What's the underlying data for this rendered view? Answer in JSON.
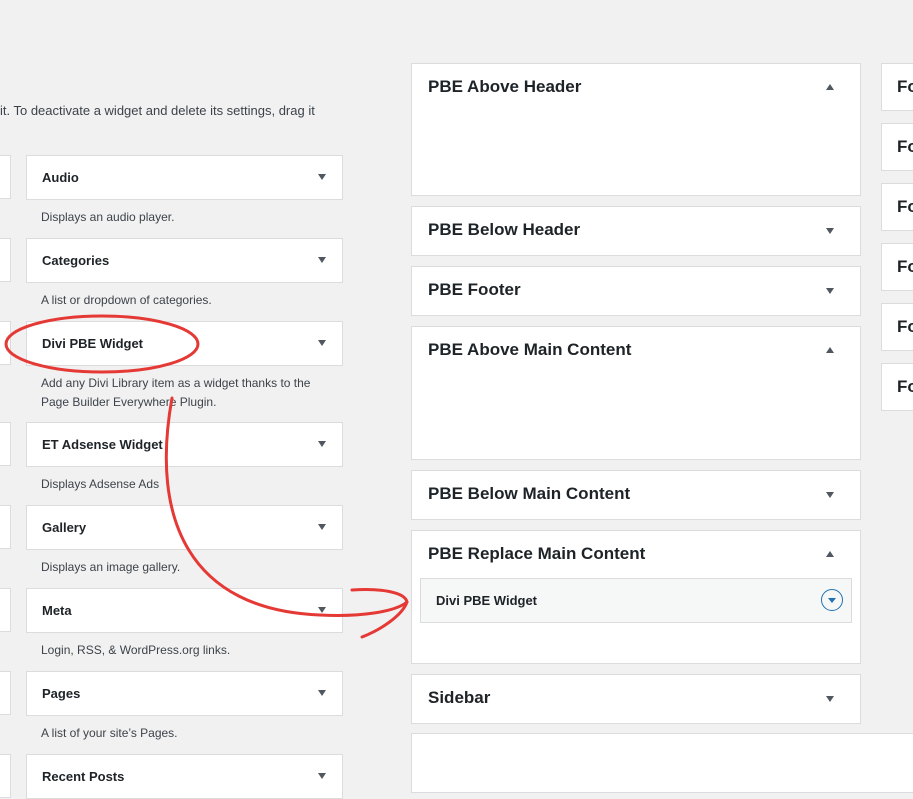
{
  "intro_text": "it. To deactivate a widget and delete its settings, drag it",
  "available_widgets": [
    {
      "title": "Audio",
      "description": "Displays an audio player."
    },
    {
      "title": "Categories",
      "description": "A list or dropdown of categories."
    },
    {
      "title": "Divi PBE Widget",
      "description": "Add any Divi Library item as a widget thanks to the Page Builder Everywhere Plugin."
    },
    {
      "title": "ET Adsense Widget",
      "description": "Displays Adsense Ads"
    },
    {
      "title": "Gallery",
      "description": "Displays an image gallery."
    },
    {
      "title": "Meta",
      "description": "Login, RSS, & WordPress.org links."
    },
    {
      "title": "Pages",
      "description": "A list of your site’s Pages."
    },
    {
      "title": "Recent Posts",
      "description": ""
    }
  ],
  "sidebars": [
    {
      "title": "PBE Above Header",
      "state": "expanded"
    },
    {
      "title": "PBE Below Header",
      "state": "collapsed"
    },
    {
      "title": "PBE Footer",
      "state": "collapsed"
    },
    {
      "title": "PBE Above Main Content",
      "state": "expanded"
    },
    {
      "title": "PBE Below Main Content",
      "state": "collapsed"
    },
    {
      "title": "PBE Replace Main Content",
      "state": "expanded",
      "widgets": [
        "Divi PBE Widget"
      ]
    },
    {
      "title": "Sidebar",
      "state": "collapsed"
    }
  ],
  "right_column_tiles": [
    "Fo",
    "Fo",
    "Fo",
    "Fo",
    "Fo",
    "Fo"
  ],
  "annotation_color": "#e53935",
  "accent_color": "#2271b1"
}
